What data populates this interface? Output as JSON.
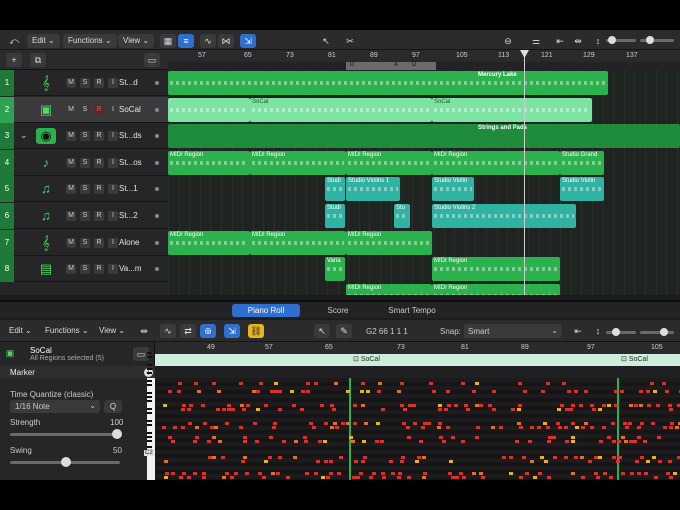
{
  "toolbar": {
    "edit": "Edit",
    "functions": "Functions",
    "view": "View"
  },
  "ruler": {
    "bars": [
      "57",
      "65",
      "73",
      "81",
      "89",
      "97",
      "105",
      "113",
      "121",
      "129",
      "137"
    ]
  },
  "markers": {
    "letters": [
      "D",
      "A",
      "D"
    ]
  },
  "tracks": [
    {
      "num": "1",
      "icon": "piano-icon",
      "name": "St...d"
    },
    {
      "num": "2",
      "icon": "drum-machine-icon",
      "name": "SoCal"
    },
    {
      "num": "3",
      "icon": "summing-stack-icon",
      "name": "St...ds"
    },
    {
      "num": "4",
      "icon": "violin-icon",
      "name": "St...os"
    },
    {
      "num": "5",
      "icon": "violins-icon",
      "name": "St...1"
    },
    {
      "num": "6",
      "icon": "violins-icon",
      "name": "St...2"
    },
    {
      "num": "7",
      "icon": "piano-icon",
      "name": "Alone"
    },
    {
      "num": "8",
      "icon": "keyboard-synth-icon",
      "name": "Va...m"
    }
  ],
  "track_buttons": [
    "M",
    "S",
    "R",
    "I"
  ],
  "regions": {
    "mercury_lake": "Mercury Lake",
    "socal": "SoCal",
    "strings_pads": "Strings and Pads",
    "midi_region": "MIDI Region",
    "studio_grand": "Studio Grand",
    "studi": "Studi",
    "studio_violins_1": "Studio Violins 1",
    "studio_violin": "Studio Violin",
    "studio_violins_2": "Studio Violins 2",
    "stu": "Stu",
    "varia": "Varia"
  },
  "lower_tabs": [
    "Piano Roll",
    "Score",
    "Smart Tempo"
  ],
  "piano_roll": {
    "edit": "Edit",
    "functions": "Functions",
    "view": "View",
    "position": "G2  66 1 1 1",
    "snap_label": "Snap:",
    "snap_value": "Smart",
    "bars": [
      "49",
      "57",
      "65",
      "73",
      "81",
      "89",
      "97",
      "105"
    ],
    "region_label": "SoCal",
    "key_label": "C2"
  },
  "inspector": {
    "region_name": "SoCal",
    "region_info": "All Regions selected (5)",
    "marker": "Marker",
    "time_quantize": "Time Quantize (classic)",
    "quantize_value": "1/16 Note",
    "q_button": "Q",
    "strength_label": "Strength",
    "strength_value": "100",
    "swing_label": "Swing",
    "swing_value": "50"
  },
  "colors": {
    "region_green": "#2bb14d",
    "region_teal": "#31b3a3",
    "accent_blue": "#2f6fce",
    "note_red": "#d8322a"
  }
}
